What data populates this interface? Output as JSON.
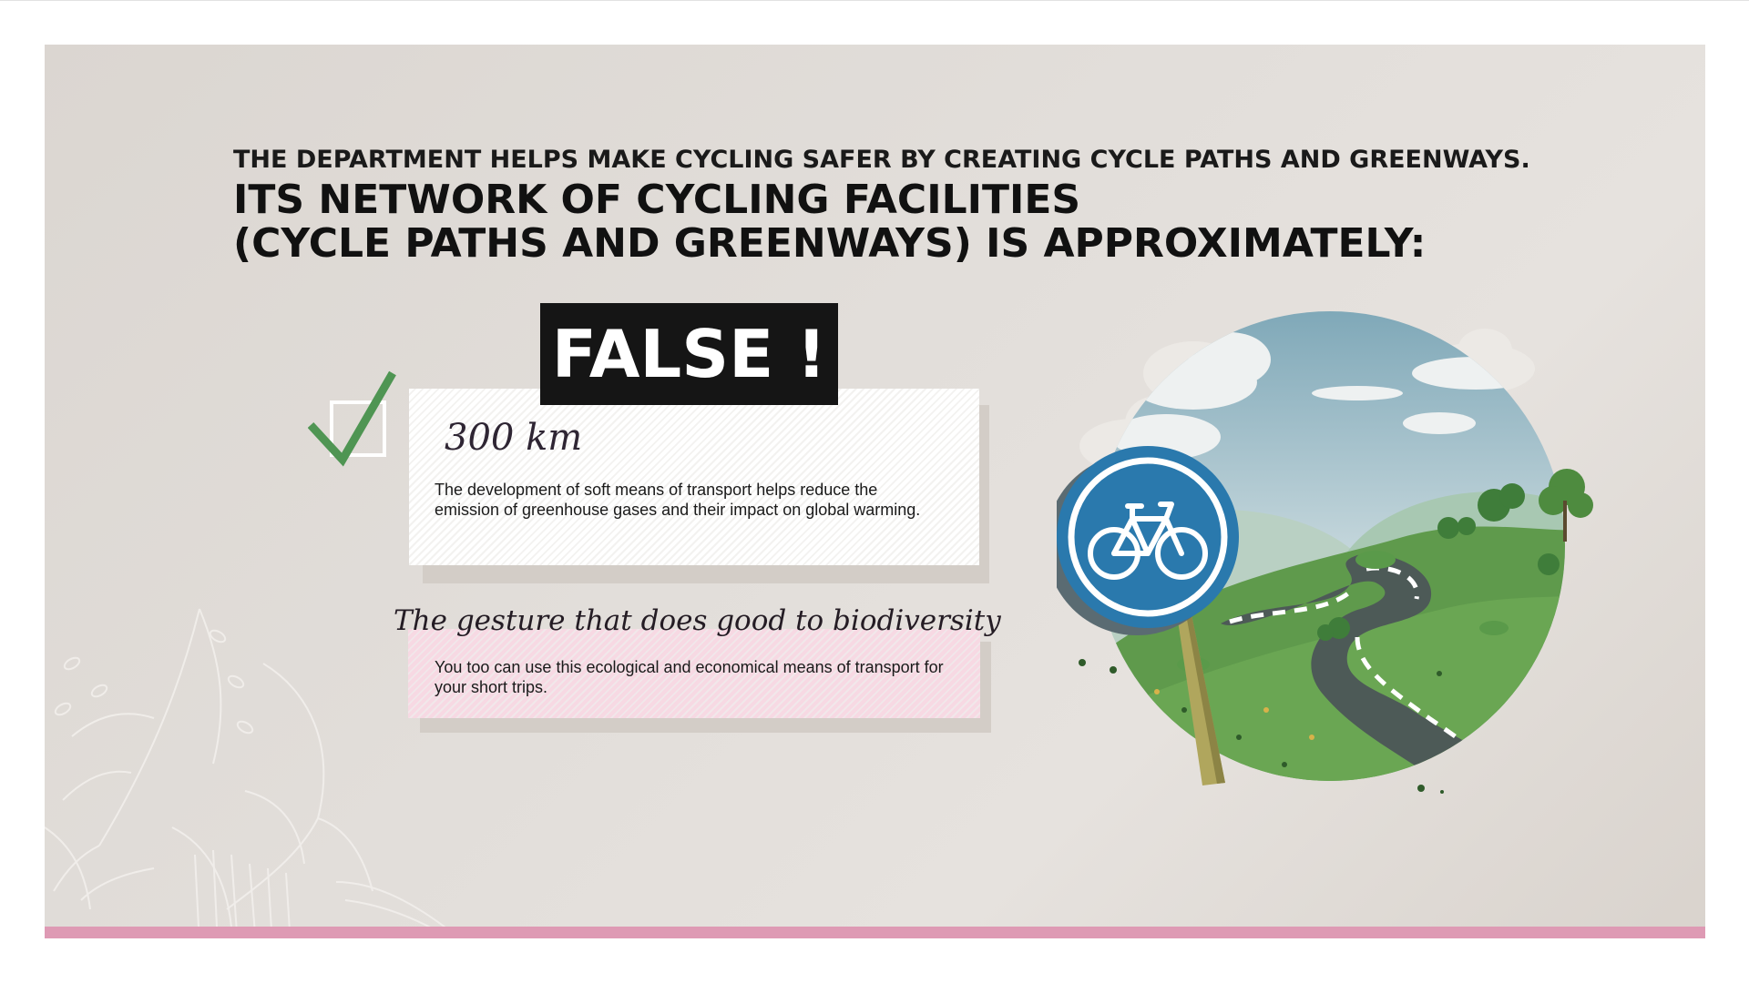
{
  "intro": "THE DEPARTMENT HELPS MAKE CYCLING SAFER BY CREATING CYCLE PATHS AND GREENWAYS.",
  "question": {
    "line1": "ITS NETWORK OF CYCLING FACILITIES",
    "line2": "(CYCLE PATHS AND GREENWAYS) IS APPROXIMATELY:"
  },
  "verdict": "FALSE !",
  "answer": {
    "value": "300 km",
    "explanation": "The development of soft means of transport helps reduce the emission of greenhouse gases and their impact on global warming."
  },
  "tip": {
    "title": "The gesture that does good to biodiversity",
    "text": "You too can use this ecological and economical means of transport for your short trips."
  },
  "icons": {
    "check": "check-mark-icon",
    "sign": "bicycle-sign-icon",
    "illustration": "cycle-path-landscape"
  },
  "colors": {
    "background": "#e0dbd6",
    "accent_pink": "#de9ab4",
    "check_green": "#4f9553",
    "verdict_bg": "#151515",
    "sign_blue": "#2a79ad"
  }
}
